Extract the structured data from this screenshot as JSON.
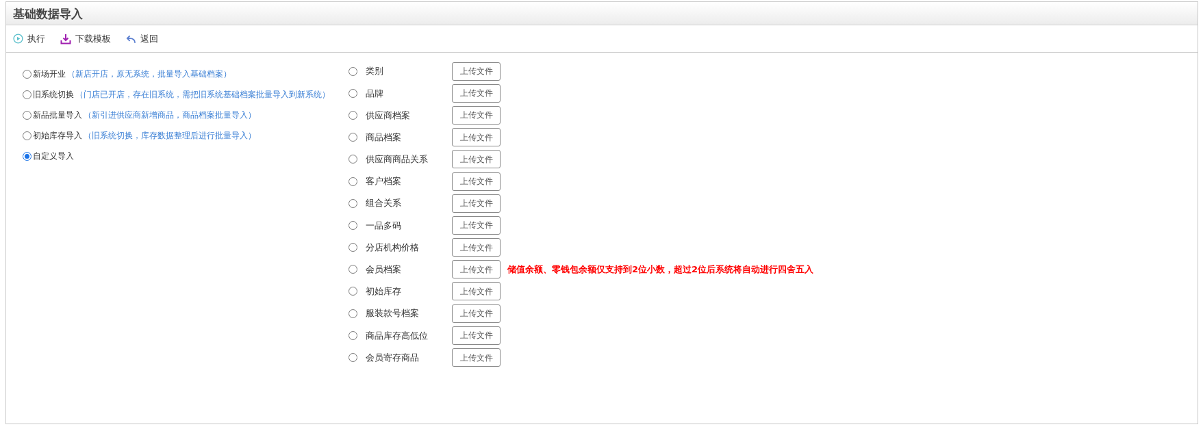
{
  "window": {
    "title": "基础数据导入"
  },
  "toolbar": [
    {
      "kind": "run",
      "label": "执行"
    },
    {
      "kind": "download",
      "label": "下载模板"
    },
    {
      "kind": "back",
      "label": "返回"
    }
  ],
  "import_modes": [
    {
      "label": "新场开业",
      "description": "（新店开店，原无系统，批量导入基础档案）",
      "selected": false
    },
    {
      "label": "旧系统切换",
      "description": "（门店已开店，存在旧系统，需把旧系统基础档案批量导入到新系统）",
      "selected": false
    },
    {
      "label": "新品批量导入",
      "description": "（新引进供应商新增商品，商品档案批量导入）",
      "selected": false
    },
    {
      "label": "初始库存导入",
      "description": "（旧系统切换，库存数据整理后进行批量导入）",
      "selected": false
    },
    {
      "label": "自定义导入",
      "selected": true
    }
  ],
  "data_types": [
    {
      "label": "类别",
      "selected": false,
      "button": "上传文件"
    },
    {
      "label": "品牌",
      "selected": false,
      "button": "上传文件"
    },
    {
      "label": "供应商档案",
      "selected": false,
      "button": "上传文件"
    },
    {
      "label": "商品档案",
      "selected": false,
      "button": "上传文件"
    },
    {
      "label": "供应商商品关系",
      "selected": false,
      "button": "上传文件"
    },
    {
      "label": "客户档案",
      "selected": false,
      "button": "上传文件"
    },
    {
      "label": "组合关系",
      "selected": false,
      "button": "上传文件"
    },
    {
      "label": "一品多码",
      "selected": false,
      "button": "上传文件"
    },
    {
      "label": "分店机构价格",
      "selected": false,
      "button": "上传文件"
    },
    {
      "label": "会员档案",
      "selected": false,
      "button": "上传文件",
      "note": "储值余额、零钱包余额仅支持到2位小数，超过2位后系统将自动进行四舍五入"
    },
    {
      "label": "初始库存",
      "selected": false,
      "button": "上传文件"
    },
    {
      "label": "服装款号档案",
      "selected": false,
      "button": "上传文件"
    },
    {
      "label": "商品库存高低位",
      "selected": false,
      "button": "上传文件"
    },
    {
      "label": "会员寄存商品",
      "selected": false,
      "button": "上传文件"
    }
  ]
}
